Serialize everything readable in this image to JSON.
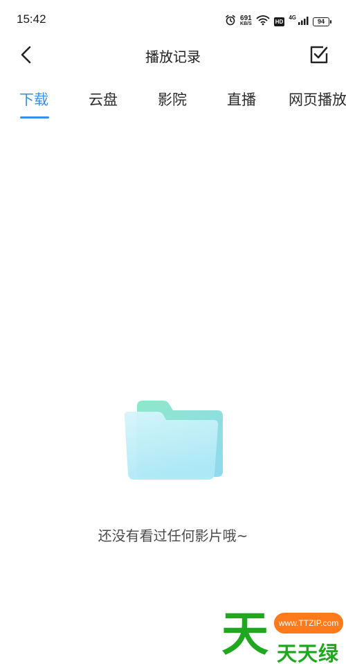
{
  "status_bar": {
    "time": "15:42",
    "net_speed_value": "691",
    "net_speed_unit": "KB/S",
    "hd_label": "HD",
    "network_type": "4G",
    "battery_level": "94",
    "icons": [
      "alarm-icon",
      "wifi-icon",
      "hd-icon",
      "signal-icon",
      "battery-icon"
    ]
  },
  "header": {
    "title": "播放记录",
    "back_icon": "chevron-left-icon",
    "edit_icon": "checkbox-edit-icon"
  },
  "tabs": [
    {
      "label": "下载",
      "active": true
    },
    {
      "label": "云盘",
      "active": false
    },
    {
      "label": "影院",
      "active": false
    },
    {
      "label": "直播",
      "active": false
    },
    {
      "label": "网页播放",
      "active": false
    }
  ],
  "empty_state": {
    "message": "还没有看过任何影片哦~",
    "icon": "folder-icon"
  },
  "watermark": {
    "big_char": "天",
    "url": "www.TTZIP.com",
    "brand": "天天绿软"
  },
  "colors": {
    "accent": "#3a8ee6",
    "text_primary": "#1f1f1f",
    "text_secondary": "#4a4a4a",
    "folder_front": "#bdeef8",
    "folder_back": "#8fe6cf",
    "watermark_green": "#1fa81f",
    "watermark_orange": "#ff7a1a"
  }
}
